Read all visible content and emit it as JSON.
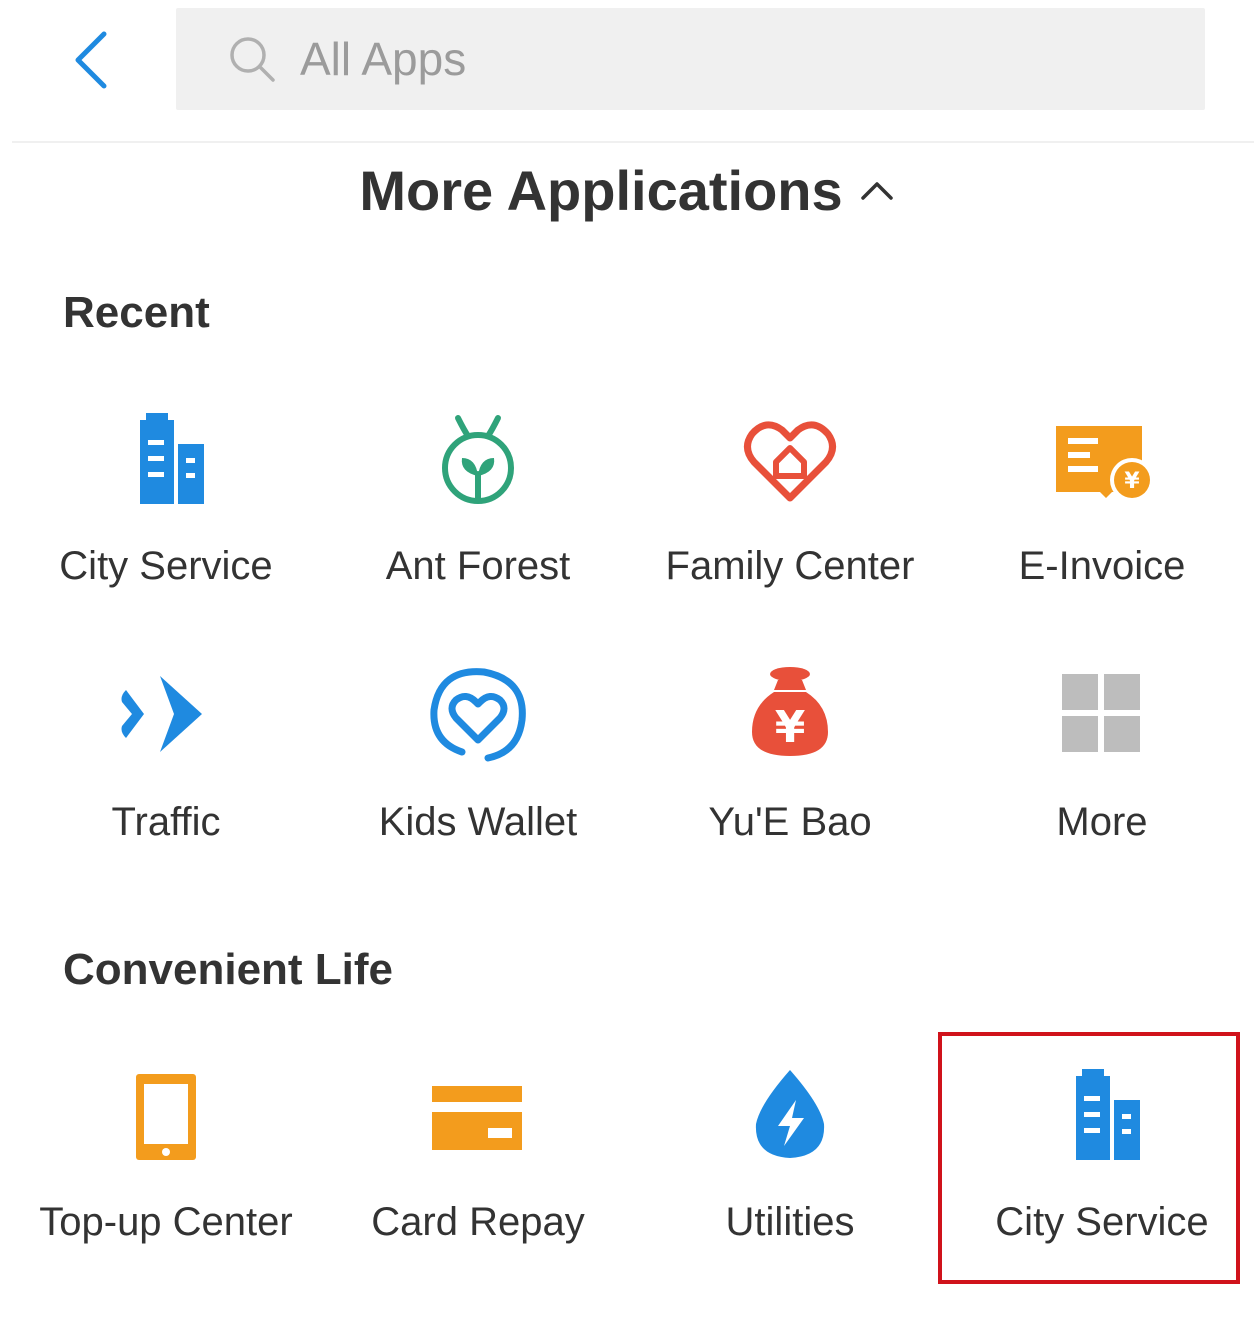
{
  "header": {
    "search_placeholder": "All Apps",
    "back_icon": "chevron-left-icon",
    "search_icon": "search-icon"
  },
  "page_title": "More Applications",
  "sections": [
    {
      "title": "Recent",
      "apps": [
        {
          "label": "City Service",
          "icon": "city-building-icon",
          "color": "#1f8ae0"
        },
        {
          "label": "Ant Forest",
          "icon": "sprout-icon",
          "color": "#2fa37a"
        },
        {
          "label": "Family Center",
          "icon": "heart-house-icon",
          "color": "#e8503a"
        },
        {
          "label": "E-Invoice",
          "icon": "invoice-yuan-icon",
          "color": "#f39c1d"
        },
        {
          "label": "Traffic",
          "icon": "double-chevron-icon",
          "color": "#1f8ae0"
        },
        {
          "label": "Kids Wallet",
          "icon": "heart-circle-icon",
          "color": "#1f8ae0"
        },
        {
          "label": "Yu'E Bao",
          "icon": "money-bag-icon",
          "color": "#e8503a"
        },
        {
          "label": "More",
          "icon": "grid-icon",
          "color": "#bdbdbd"
        }
      ]
    },
    {
      "title": "Convenient Life",
      "apps": [
        {
          "label": "Top-up Center",
          "icon": "phone-icon",
          "color": "#f39c1d"
        },
        {
          "label": "Card Repay",
          "icon": "card-icon",
          "color": "#f39c1d"
        },
        {
          "label": "Utilities",
          "icon": "water-drop-bolt-icon",
          "color": "#1f8ae0"
        },
        {
          "label": "City Service",
          "icon": "city-building-icon",
          "color": "#1f8ae0"
        }
      ]
    }
  ],
  "colors": {
    "accent": "#1f8ae0",
    "highlight_border": "#d0121b",
    "search_bg": "#f0f0f0"
  }
}
